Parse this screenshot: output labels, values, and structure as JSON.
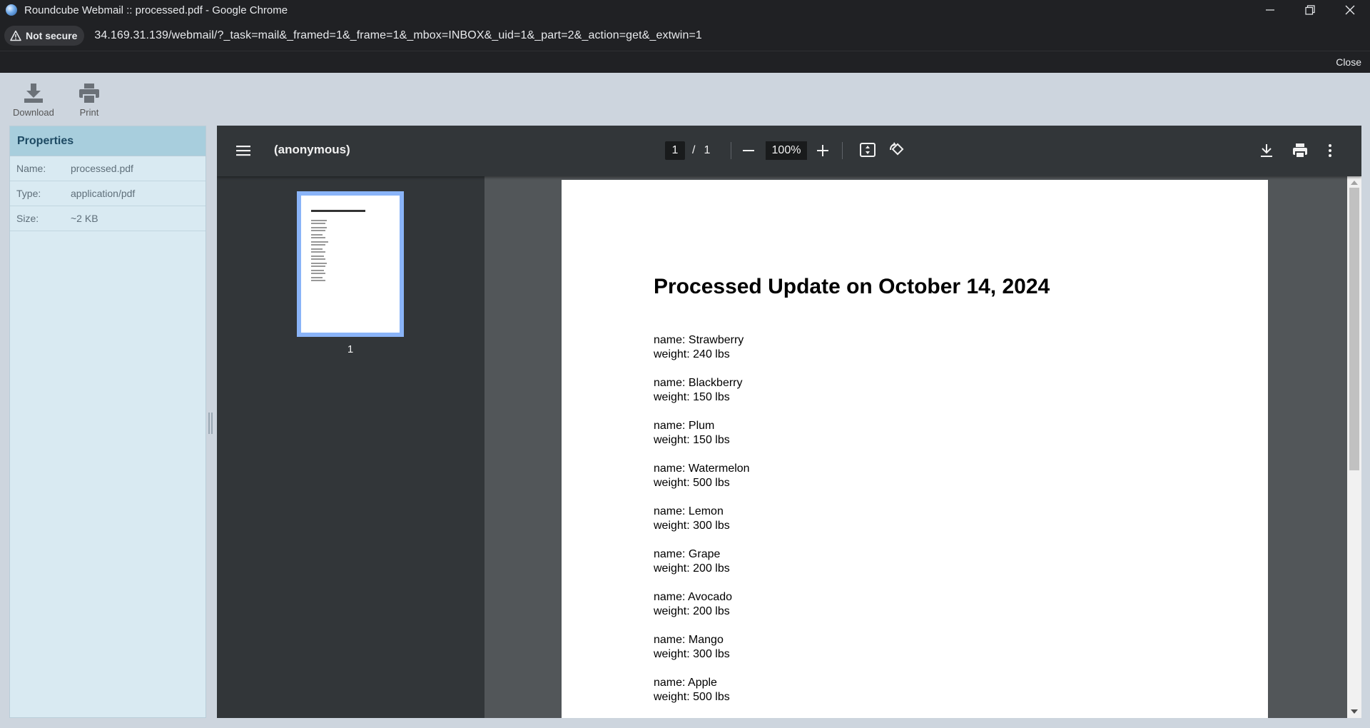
{
  "window": {
    "title": "Roundcube Webmail :: processed.pdf - Google Chrome"
  },
  "address": {
    "security_label": "Not secure",
    "url": "34.169.31.139/webmail/?_task=mail&_framed=1&_frame=1&_mbox=INBOX&_uid=1&_part=2&_action=get&_extwin=1"
  },
  "topbar": {
    "close_label": "Close"
  },
  "toolbar": {
    "download_label": "Download",
    "print_label": "Print"
  },
  "properties": {
    "title": "Properties",
    "rows": [
      {
        "key": "Name:",
        "value": "processed.pdf"
      },
      {
        "key": "Type:",
        "value": "application/pdf"
      },
      {
        "key": "Size:",
        "value": "~2 KB"
      }
    ]
  },
  "pdf": {
    "doc_title": "(anonymous)",
    "current_page": "1",
    "page_separator": "/",
    "total_pages": "1",
    "zoom": "100%",
    "thumbnail_label": "1",
    "heading": "Processed Update on October 14, 2024",
    "entries": [
      {
        "name": "name: Strawberry",
        "weight": "weight: 240 lbs"
      },
      {
        "name": "name: Blackberry",
        "weight": "weight: 150 lbs"
      },
      {
        "name": "name: Plum",
        "weight": "weight: 150 lbs"
      },
      {
        "name": "name: Watermelon",
        "weight": "weight: 500 lbs"
      },
      {
        "name": "name: Lemon",
        "weight": "weight: 300 lbs"
      },
      {
        "name": "name: Grape",
        "weight": "weight: 200 lbs"
      },
      {
        "name": "name: Avocado",
        "weight": "weight: 200 lbs"
      },
      {
        "name": "name: Mango",
        "weight": "weight: 300 lbs"
      },
      {
        "name": "name: Apple",
        "weight": "weight: 500 lbs"
      }
    ]
  }
}
